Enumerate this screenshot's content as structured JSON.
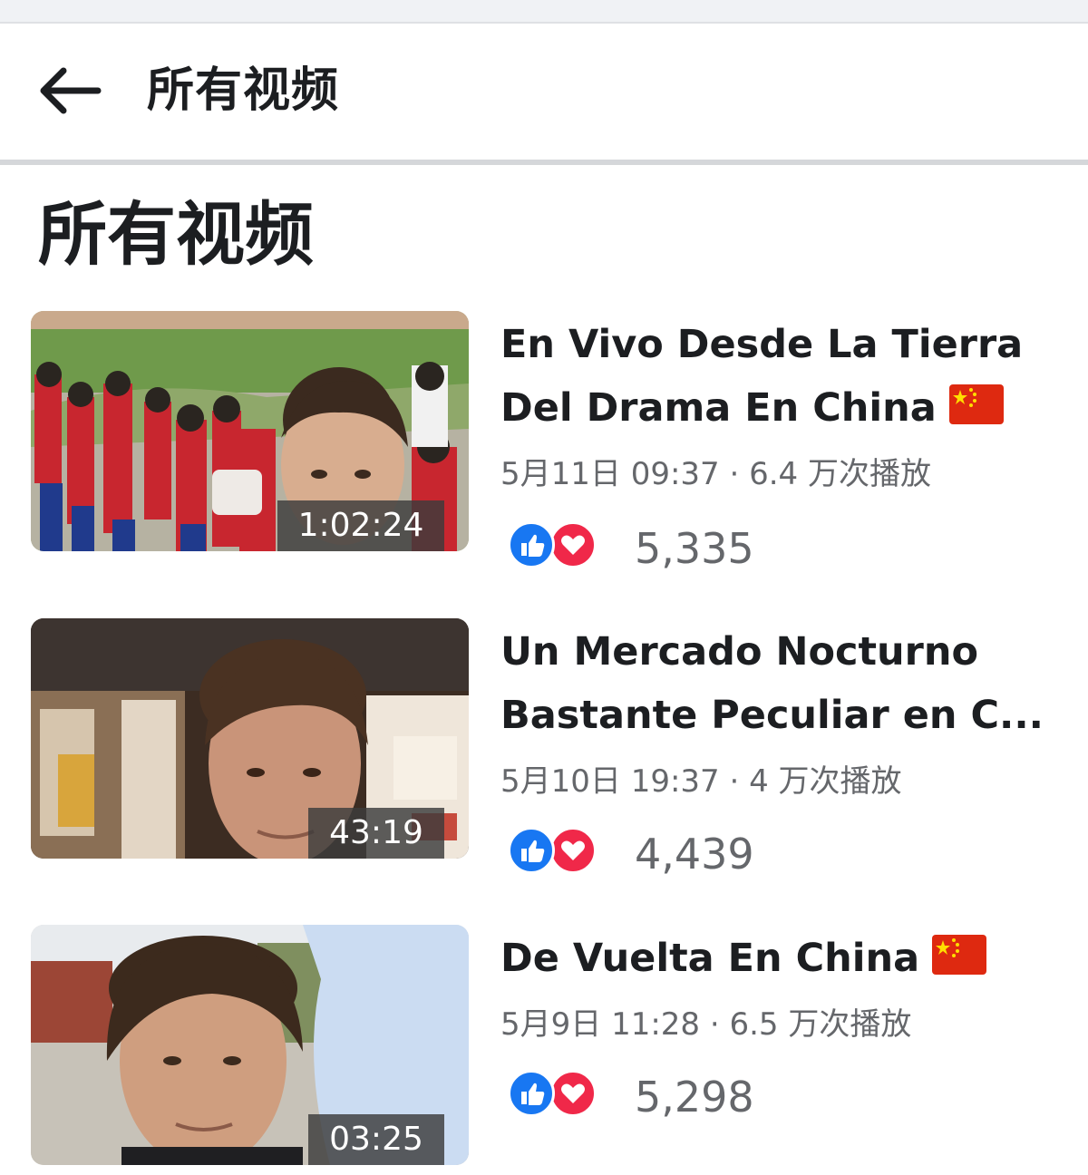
{
  "header": {
    "title": "所有视频"
  },
  "section": {
    "title": "所有视频"
  },
  "videos": [
    {
      "title_line1": "En Vivo Desde La Tierra",
      "title_line2": "Del Drama En China",
      "flag_after": true,
      "meta": "5月11日 09:37 · 6.4 万次播放",
      "duration": "1:02:24",
      "reactions": "5,335"
    },
    {
      "title_line1": "Un Mercado Nocturno",
      "title_line2": "Bastante Peculiar en C...",
      "flag_after": false,
      "meta": "5月10日 19:37 · 4 万次播放",
      "duration": "43:19",
      "reactions": "4,439"
    },
    {
      "title_line1": "De Vuelta En China",
      "title_line2": "",
      "flag_after": true,
      "meta": "5月9日 11:28 · 6.5 万次播放",
      "duration": "03:25",
      "reactions": "5,298"
    }
  ],
  "icons": {
    "back": "arrow-left-icon",
    "like": "thumbs-up-icon",
    "love": "heart-icon",
    "flag": "china-flag-icon"
  },
  "colors": {
    "like": "#1877f2",
    "love": "#f02849",
    "meta_text": "#65676b",
    "primary_text": "#1c1e21"
  }
}
